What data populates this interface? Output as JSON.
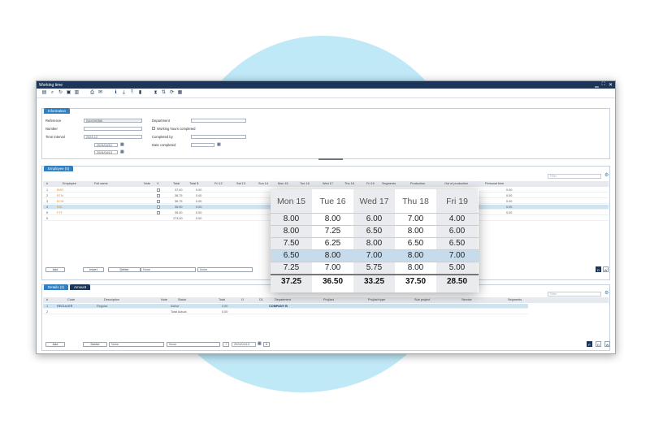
{
  "window": {
    "title": "Working time",
    "ctrls": [
      "▁",
      "⛶",
      "✕"
    ]
  },
  "information": {
    "tab": "Information",
    "reference_label": "Reference",
    "reference_value": "SAX000366",
    "number_label": "Number",
    "number_value": "",
    "interval_label": "Time interval",
    "interval_value": "2024-12",
    "date_from": "2024/04/12",
    "date_to": "2024/04/13",
    "department_label": "Department",
    "department_value": "",
    "working_completed_label": "Working hours completed",
    "completed_by_label": "Completed by",
    "completed_by_value": "",
    "date_completed_label": "Date completed",
    "date_completed_value": ""
  },
  "employee": {
    "tab": "Employee (5)",
    "filter_placeholder": "Filter",
    "headers": [
      "#",
      "Employee",
      "Full name",
      "Note",
      "V",
      "Total",
      "Total $",
      "Fri 12",
      "Sat 13",
      "Sun 14",
      "Mon 15",
      "Tue 16",
      "Wed 17",
      "Thu 18",
      "Fri 19",
      "Segments",
      "Production",
      "Out of production",
      "Personal time"
    ],
    "rows": [
      {
        "num": "1",
        "code": "BHR",
        "total": "37.00",
        "totald": "0.00",
        "personal": "0.00"
      },
      {
        "num": "2",
        "code": "BTM",
        "total": "38.75",
        "totald": "0.00",
        "personal": "0.00"
      },
      {
        "num": "3",
        "code": "BYM",
        "total": "36.75",
        "totald": "0.00",
        "personal": "0.00"
      },
      {
        "num": "4",
        "code": "EDL",
        "total": "36.90",
        "totald": "0.00",
        "personal": "0.00"
      },
      {
        "num": "5",
        "code": "FTF",
        "total": "35.00",
        "totald": "0.00",
        "personal": "0.00"
      }
    ],
    "total_row": {
      "num": "5",
      "total": "173.00",
      "totald": "0.00"
    },
    "buttons": {
      "add": "Add",
      "insert": "Insert",
      "delete": "Delete"
    },
    "select1": "None",
    "select2": "None",
    "view_buttons": [
      "D",
      "W"
    ]
  },
  "details": {
    "tab1": "Details (2)",
    "tab2": "Amount",
    "filter_placeholder": "Filter",
    "headers": [
      "#",
      "Code",
      "Description",
      "Note",
      "Statut",
      "Total",
      "I1",
      "D1",
      "Department",
      "Proj/act",
      "Proj/act type",
      "Sub project",
      "Service",
      "Segments"
    ],
    "rows": [
      {
        "num": "1",
        "code": "REGULIER",
        "desc": "Regular",
        "statut": "Active",
        "total": "0.00",
        "dept": "COMPANY B"
      },
      {
        "num": "2",
        "code": "",
        "desc": "",
        "statut": "Total Actual",
        "total": "0.00",
        "dept": ""
      }
    ],
    "buttons": {
      "add": "Add",
      "delete": "Delete"
    },
    "select1": "None",
    "select2": "None",
    "date": "2024/04/13",
    "view_buttons": [
      "P",
      "D",
      "W"
    ]
  },
  "zoom": {
    "headers": [
      "Mon 15",
      "Tue 16",
      "Wed 17",
      "Thu 18",
      "Fri 19"
    ],
    "rows": [
      [
        "8.00",
        "8.00",
        "6.00",
        "7.00",
        "4.00"
      ],
      [
        "8.00",
        "7.25",
        "6.50",
        "8.00",
        "6.00"
      ],
      [
        "7.50",
        "6.25",
        "8.00",
        "6.50",
        "6.50"
      ],
      [
        "6.50",
        "8.00",
        "7.00",
        "8.00",
        "7.00"
      ],
      [
        "7.25",
        "7.00",
        "5.75",
        "8.00",
        "5.00"
      ]
    ],
    "totals": [
      "37.25",
      "36.50",
      "33.25",
      "37.50",
      "28.50"
    ],
    "selected_row": 3
  },
  "colors": {
    "brand": "#1d3557",
    "accent": "#2f80c2",
    "highlight": "#cfe3f1",
    "circle": "#bfe9f7"
  }
}
